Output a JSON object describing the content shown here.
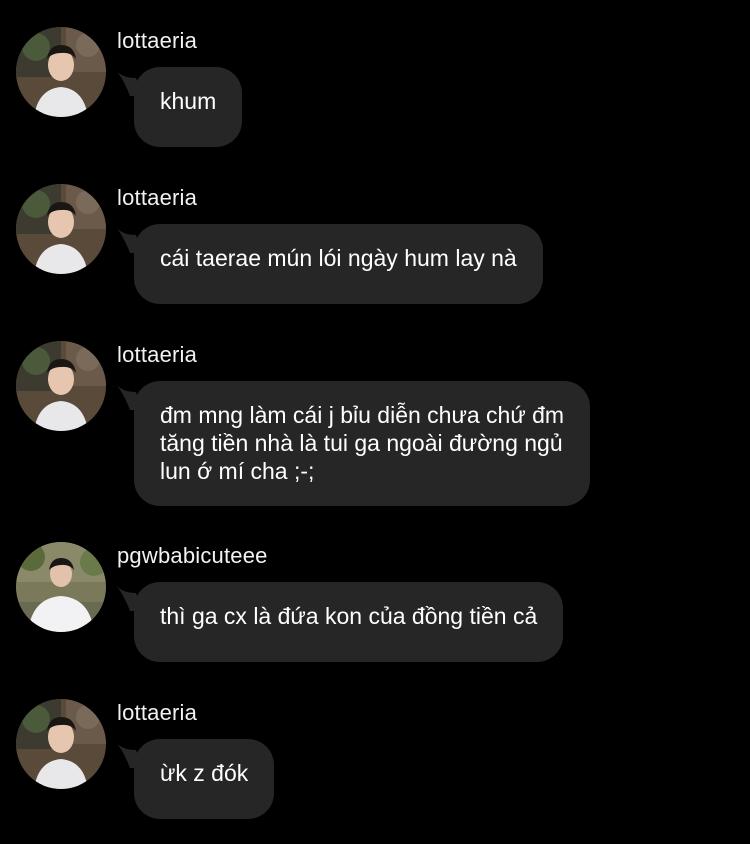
{
  "messages": [
    {
      "sender": "lottaeria",
      "text": "khum",
      "avatar": "lottaeria-avatar"
    },
    {
      "sender": "lottaeria",
      "text": "cái taerae mún lói ngày hum lay nà",
      "avatar": "lottaeria-avatar"
    },
    {
      "sender": "lottaeria",
      "lines": [
        "đm mng làm cái j bỉu diễn chưa chứ đm",
        "tăng tiền nhà là tui ga ngoài đường ngủ",
        "lun ớ mí cha ;-;"
      ],
      "avatar": "lottaeria-avatar"
    },
    {
      "sender": "pgwbabicuteee",
      "text": "thì ga cx là đứa kon của đồng tiền cả",
      "avatar": "pgwbabicuteee-avatar"
    },
    {
      "sender": "lottaeria",
      "text": "ừk z đók",
      "avatar": "lottaeria-avatar"
    }
  ],
  "colors": {
    "background": "#000000",
    "bubble": "#262626",
    "text": "#ffffff"
  }
}
